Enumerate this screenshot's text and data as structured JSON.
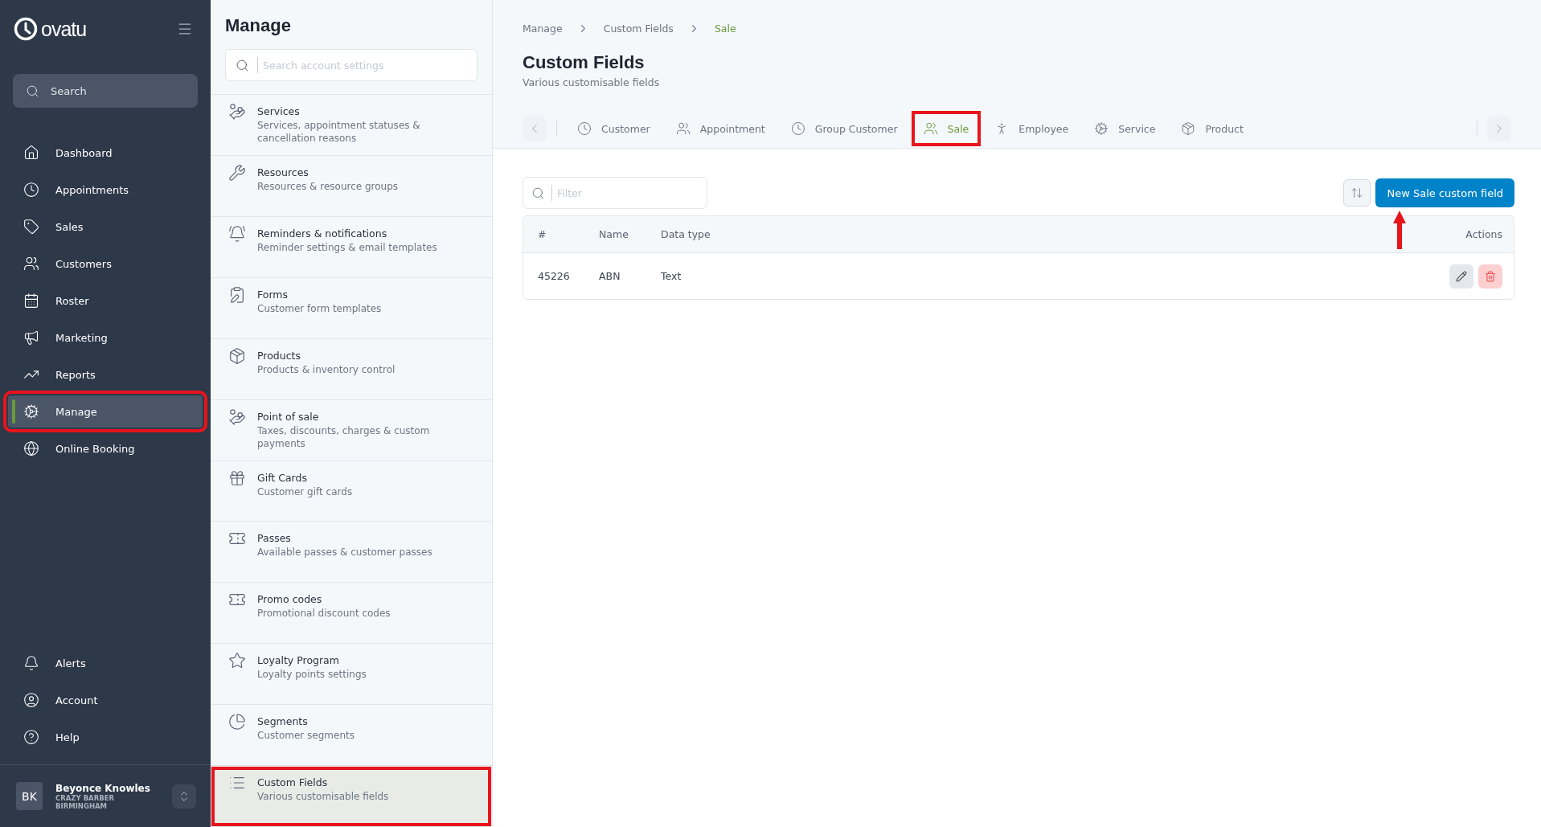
{
  "sidebar": {
    "logo": "ovatu",
    "search": {
      "label": "Search"
    },
    "nav": [
      {
        "label": "Dashboard",
        "selected": false,
        "annotated": false
      },
      {
        "label": "Appointments",
        "selected": false,
        "annotated": false
      },
      {
        "label": "Sales",
        "selected": false,
        "annotated": false
      },
      {
        "label": "Customers",
        "selected": false,
        "annotated": false
      },
      {
        "label": "Roster",
        "selected": false,
        "annotated": false
      },
      {
        "label": "Marketing",
        "selected": false,
        "annotated": false
      },
      {
        "label": "Reports",
        "selected": false,
        "annotated": false
      },
      {
        "label": "Manage",
        "selected": true,
        "annotated": true
      },
      {
        "label": "Online Booking",
        "selected": false,
        "annotated": false
      }
    ],
    "footer_nav": [
      {
        "label": "Alerts"
      },
      {
        "label": "Account"
      },
      {
        "label": "Help"
      }
    ],
    "user": {
      "initials": "BK",
      "name": "Beyonce Knowles",
      "business": "CRAZY BARBER BIRMINGHAM"
    }
  },
  "manage": {
    "title": "Manage",
    "search": {
      "placeholder": "Search account settings"
    },
    "items": [
      {
        "title": "Services",
        "subtitle": "Services, appointment statuses & cancellation reasons",
        "selected": false,
        "annotated": false
      },
      {
        "title": "Resources",
        "subtitle": "Resources & resource groups",
        "selected": false,
        "annotated": false
      },
      {
        "title": "Reminders & notifications",
        "subtitle": "Reminder settings & email templates",
        "selected": false,
        "annotated": false
      },
      {
        "title": "Forms",
        "subtitle": "Customer form templates",
        "selected": false,
        "annotated": false
      },
      {
        "title": "Products",
        "subtitle": "Products & inventory control",
        "selected": false,
        "annotated": false
      },
      {
        "title": "Point of sale",
        "subtitle": "Taxes, discounts, charges & custom payments",
        "selected": false,
        "annotated": false
      },
      {
        "title": "Gift Cards",
        "subtitle": "Customer gift cards",
        "selected": false,
        "annotated": false
      },
      {
        "title": "Passes",
        "subtitle": "Available passes & customer passes",
        "selected": false,
        "annotated": false
      },
      {
        "title": "Promo codes",
        "subtitle": "Promotional discount codes",
        "selected": false,
        "annotated": false
      },
      {
        "title": "Loyalty Program",
        "subtitle": "Loyalty points settings",
        "selected": false,
        "annotated": false
      },
      {
        "title": "Segments",
        "subtitle": "Customer segments",
        "selected": false,
        "annotated": false
      },
      {
        "title": "Custom Fields",
        "subtitle": "Various customisable fields",
        "selected": true,
        "annotated": true
      }
    ]
  },
  "breadcrumb": [
    {
      "label": "Manage",
      "current": false
    },
    {
      "label": "Custom Fields",
      "current": false
    },
    {
      "label": "Sale",
      "current": true
    }
  ],
  "page": {
    "title": "Custom Fields",
    "subtitle": "Various customisable fields"
  },
  "tabs": [
    {
      "label": "Customer",
      "selected": false,
      "annotated": false
    },
    {
      "label": "Appointment",
      "selected": false,
      "annotated": false
    },
    {
      "label": "Group Customer",
      "selected": false,
      "annotated": false
    },
    {
      "label": "Sale",
      "selected": true,
      "annotated": true
    },
    {
      "label": "Employee",
      "selected": false,
      "annotated": false
    },
    {
      "label": "Service",
      "selected": false,
      "annotated": false
    },
    {
      "label": "Product",
      "selected": false,
      "annotated": false
    }
  ],
  "filter": {
    "placeholder": "Filter"
  },
  "new_button": {
    "label": "New Sale custom field",
    "annotated": true
  },
  "table": {
    "columns": [
      "#",
      "Name",
      "Data type",
      "Actions"
    ],
    "rows": [
      {
        "cells": [
          "45226",
          "ABN",
          "Text"
        ]
      }
    ]
  }
}
